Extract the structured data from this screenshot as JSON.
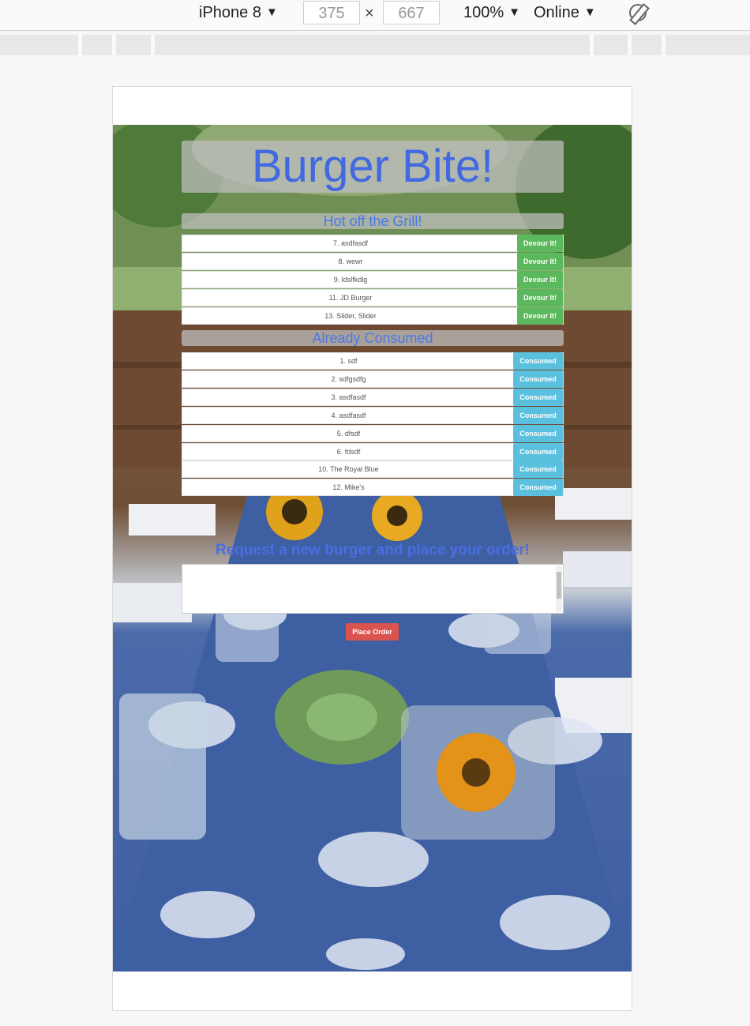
{
  "devtools": {
    "device": "iPhone 8",
    "width": "375",
    "height": "667",
    "times": "×",
    "zoom": "100%",
    "network": "Online",
    "dropdown_glyph": "▼"
  },
  "app": {
    "title": "Burger Bite!",
    "uneaten_header": "Hot off the Grill!",
    "eaten_header": "Already Consumed",
    "devour_label": "Devour It!",
    "consumed_label": "Consumed",
    "request_header": "Request a new burger and place your order!",
    "order_button": "Place Order",
    "uneaten": [
      "7. asdfasdf",
      "8. wewr",
      "9. ldslfkdlg",
      "11. JD Burger",
      "13. Slider, Slider"
    ],
    "eaten": [
      "1. sdf",
      "2. sdfgsdfg",
      "3. asdfasdf",
      "4. asdfasdf",
      "5. dfsdf",
      "6. fdsdf",
      "10. The Royal Blue",
      "12. Mike's"
    ]
  },
  "colors": {
    "title": "#4169e1",
    "devour": "#5cb85c",
    "consumed": "#5bc0de",
    "order": "#d9534f"
  }
}
